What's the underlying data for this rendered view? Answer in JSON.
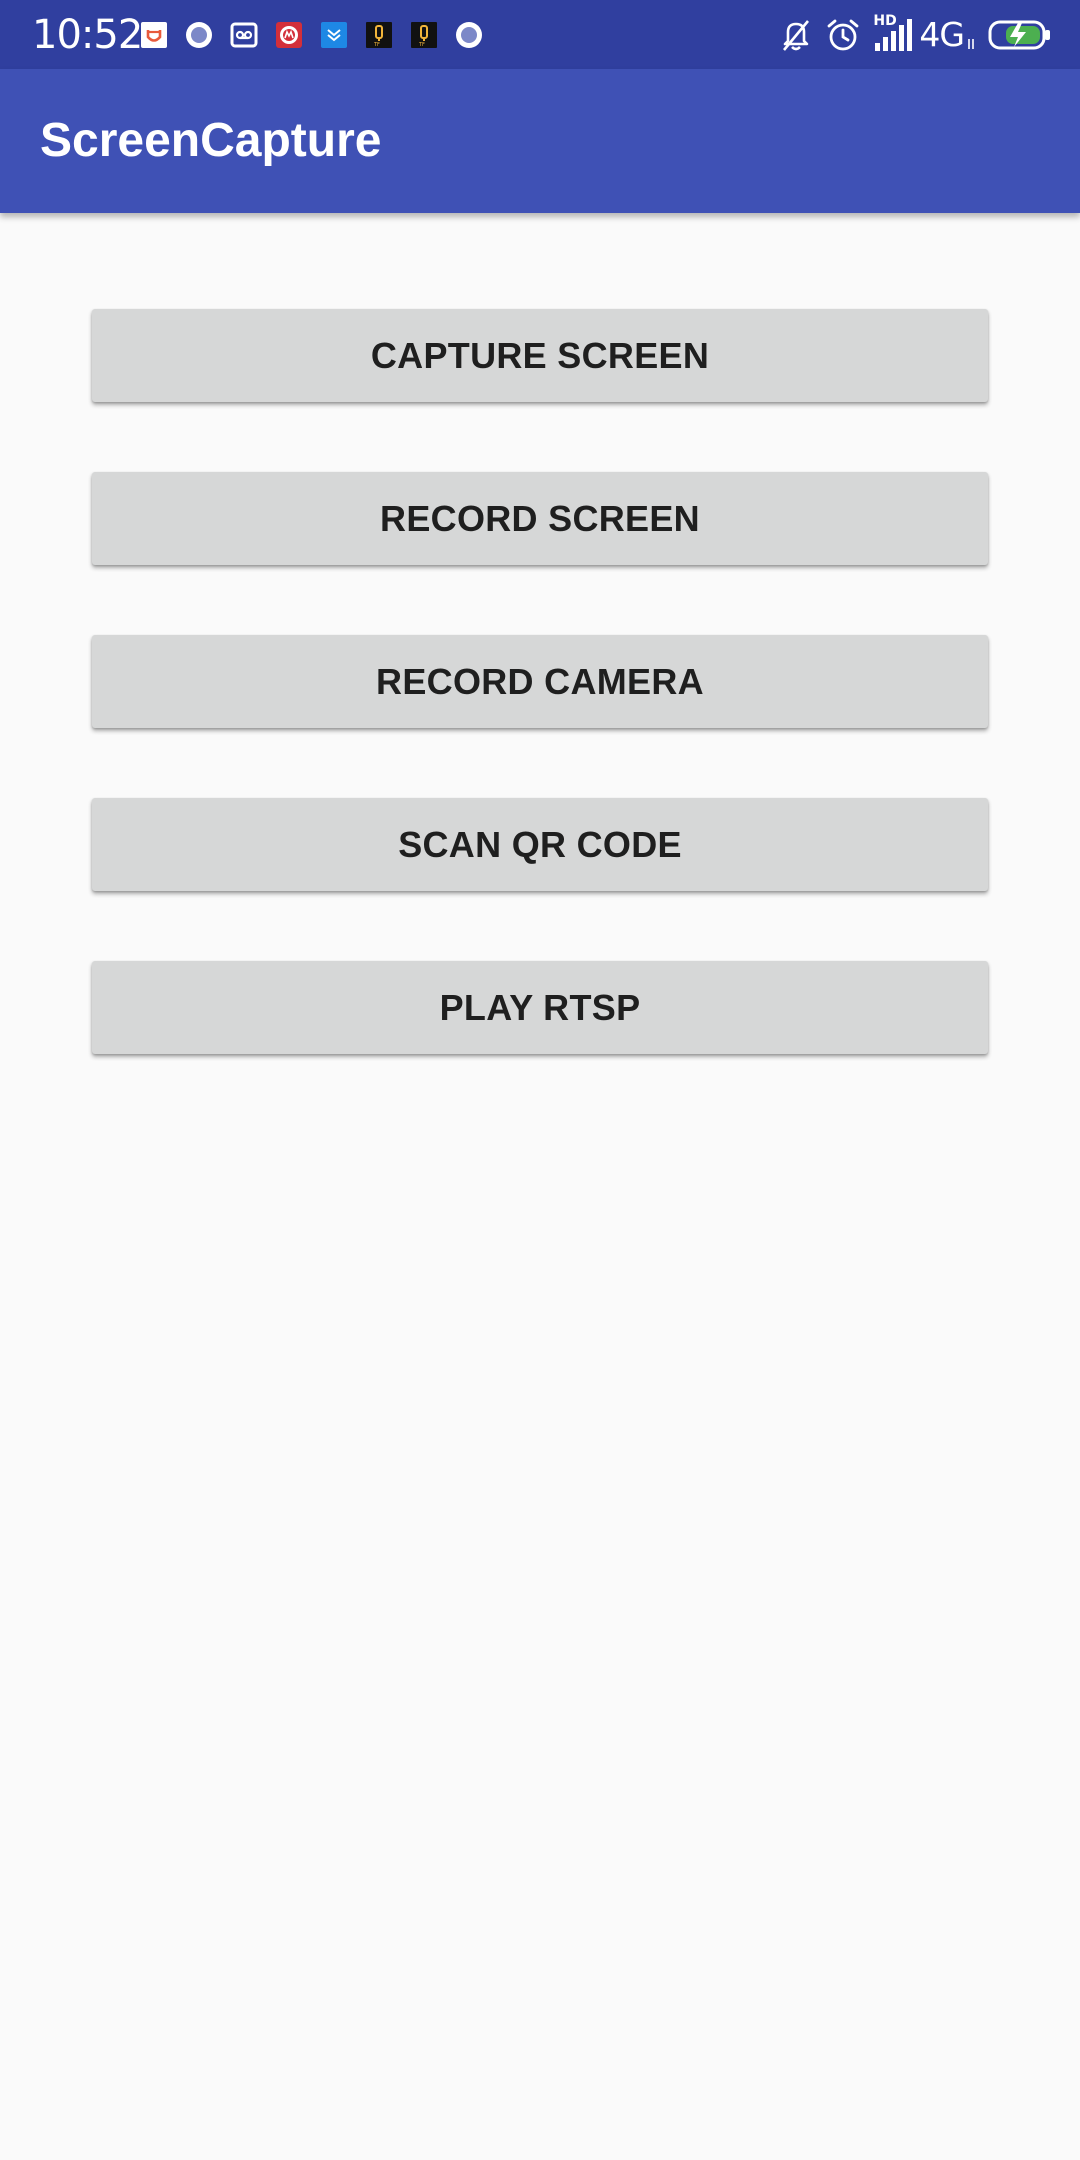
{
  "status_bar": {
    "time": "10:52",
    "network_type": "4G",
    "hd_label": "HD",
    "notification_icons": [
      "mail-icon",
      "circle-app-icon",
      "voicemail-icon",
      "red-app-icon",
      "blue-download-app-icon",
      "yellow-app-icon",
      "yellow-app-icon-2",
      "circle-app-icon-2"
    ],
    "system_icons": [
      "bell-off-icon",
      "alarm-icon",
      "signal-icon",
      "battery-charging-icon"
    ]
  },
  "app_bar": {
    "title": "ScreenCapture"
  },
  "buttons": [
    {
      "label": "CAPTURE SCREEN"
    },
    {
      "label": "RECORD SCREEN"
    },
    {
      "label": "RECORD CAMERA"
    },
    {
      "label": "SCAN QR CODE"
    },
    {
      "label": "PLAY RTSP"
    }
  ],
  "colors": {
    "status_bar": "#303f9f",
    "app_bar": "#3f51b5",
    "background": "#fafafa",
    "button": "#d6d7d7",
    "button_text": "#1f1f1f",
    "battery_fill": "#4caf50"
  }
}
